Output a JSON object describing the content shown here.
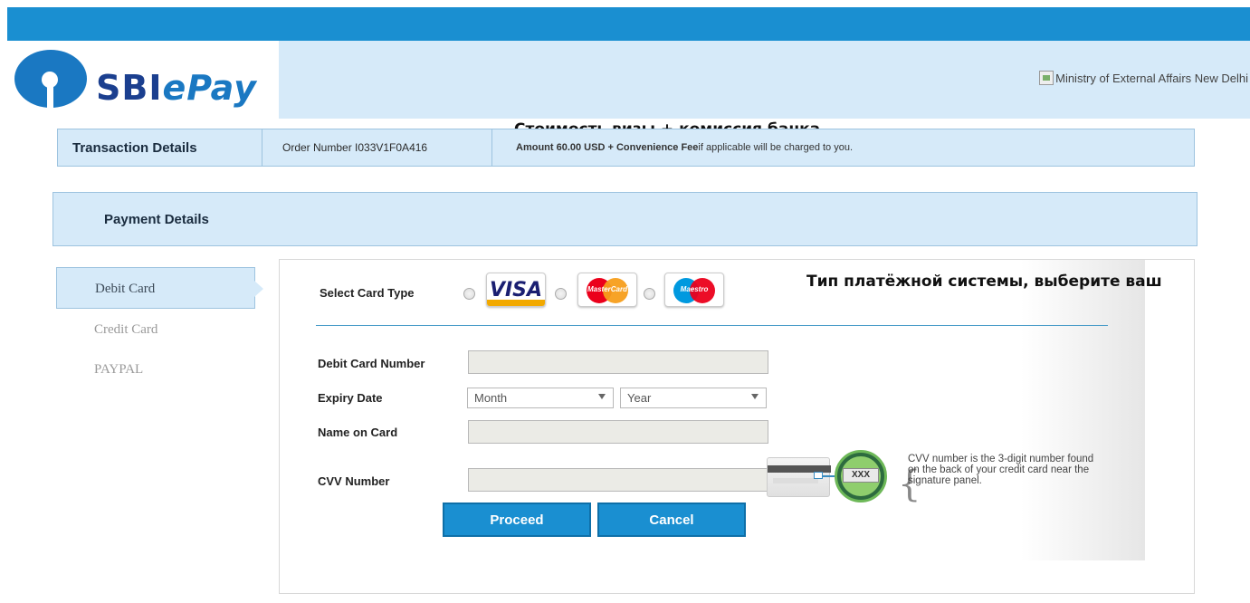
{
  "header": {
    "logo_text_sbi": "SBI",
    "logo_text_epay": "ePay",
    "ministry_alt": "Ministry of External Affairs New Delhi"
  },
  "annotations": {
    "visa_cost": "Стоимость визы + комиссия банка",
    "card_system": "Тип платёжной системы, выберите ваш"
  },
  "transaction": {
    "title": "Transaction Details",
    "order": "Order Number I033V1F0A416",
    "amount_bold": "Amount 60.00 USD + Convenience Fee",
    "amount_rest": " if applicable will be charged to you."
  },
  "payment": {
    "title": "Payment Details"
  },
  "tabs": [
    {
      "label": "Debit Card",
      "active": true
    },
    {
      "label": "Credit Card",
      "active": false
    },
    {
      "label": "PAYPAL",
      "active": false
    }
  ],
  "form": {
    "card_type_label": "Select Card Type",
    "card_types": [
      {
        "name": "VISA",
        "icon": "visa-logo"
      },
      {
        "name": "MasterCard",
        "icon": "mastercard-logo"
      },
      {
        "name": "Maestro",
        "icon": "maestro-logo"
      }
    ],
    "card_number_label": "Debit Card Number",
    "expiry_label": "Expiry Date",
    "month_placeholder": "Month",
    "year_placeholder": "Year",
    "name_label": "Name on Card",
    "cvv_label": "CVV Number",
    "cvv_sample": "XXX",
    "cvv_help": "CVV number is the 3-digit number found on the back of your credit card near the signature panel.",
    "proceed_label": "Proceed",
    "cancel_label": "Cancel"
  },
  "colors": {
    "accent": "#1a8fd1",
    "panel_bg": "#d6eaf9",
    "border": "#9dc3df"
  }
}
